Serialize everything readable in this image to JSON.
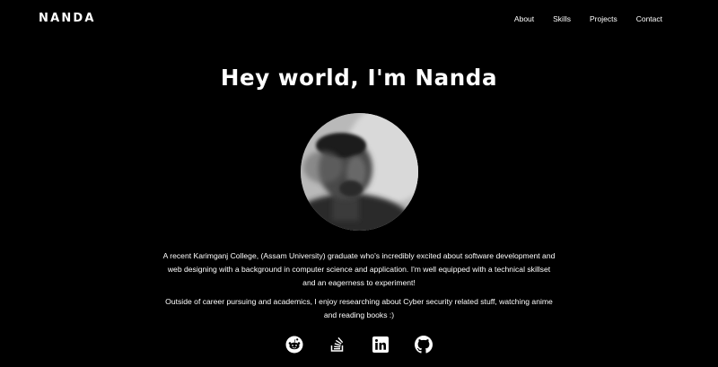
{
  "header": {
    "logo": "NANDA",
    "nav": [
      {
        "label": "About"
      },
      {
        "label": "Skills"
      },
      {
        "label": "Projects"
      },
      {
        "label": "Contact"
      }
    ]
  },
  "hero": {
    "title": "Hey world, I'm Nanda",
    "bio_1": "A recent Karimganj College, (Assam University) graduate who's incredibly excited about software development and web designing with a background in computer science and application. I'm well equipped with a technical skillset and an eagerness to experiment!",
    "bio_2": "Outside of career pursuing and academics, I enjoy researching about Cyber security related stuff, watching anime and reading books :)"
  },
  "socials": [
    {
      "icon": "reddit-icon"
    },
    {
      "icon": "stackoverflow-icon"
    },
    {
      "icon": "linkedin-icon"
    },
    {
      "icon": "github-icon"
    }
  ],
  "colors": {
    "background": "#000000",
    "text": "#ffffff"
  }
}
